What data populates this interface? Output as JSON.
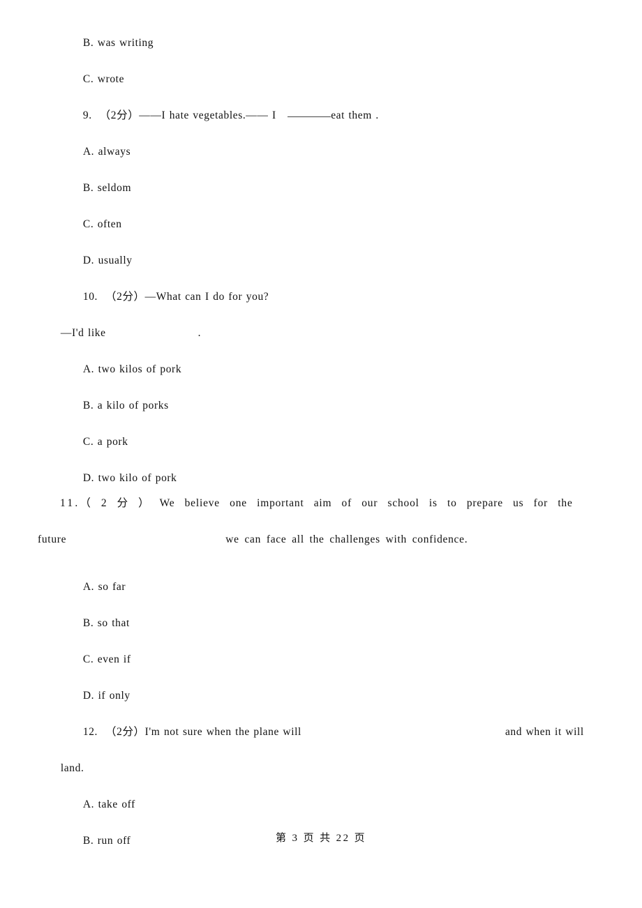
{
  "document": {
    "page_footer": "第 3 页 共 22 页"
  },
  "carryover_options": [
    {
      "letter": "B",
      "sep": ".",
      "text": "was writing"
    },
    {
      "letter": "C",
      "sep": ".",
      "text": "wrote"
    }
  ],
  "questions": [
    {
      "number": "9.",
      "score": "（2分）",
      "stem_before_blank": "——I hate vegetables.—— I",
      "blank_type": "underline",
      "stem_after_blank": "eat them .",
      "options": [
        {
          "letter": "A",
          "sep": ".",
          "text": "always"
        },
        {
          "letter": "B",
          "sep": ".",
          "text": "seldom"
        },
        {
          "letter": "C",
          "sep": ".",
          "text": "often"
        },
        {
          "letter": "D",
          "sep": ".",
          "text": "usually"
        }
      ]
    },
    {
      "number": "10.",
      "score": "（2分）",
      "stem_line1": "—What can I do for you?",
      "stem_line2_before_blank": "—I'd like",
      "blank_type": "whitespace",
      "stem_line2_after_blank": ".",
      "options": [
        {
          "letter": "A",
          "sep": ".",
          "text": "two kilos of pork"
        },
        {
          "letter": "B",
          "sep": ".",
          "text": "a kilo of porks"
        },
        {
          "letter": "C",
          "sep": ".",
          "text": "a pork"
        },
        {
          "letter": "D",
          "sep": ".",
          "text": "two kilo of pork"
        }
      ]
    },
    {
      "number": "11.",
      "score": "（ 2 分 ）",
      "stem_line1": "We believe one important aim of our school is to prepare us for the",
      "stem_line2_before_blank": "future",
      "blank_type": "whitespace",
      "stem_line2_after_blank": "we can face all the challenges with confidence.",
      "options": [
        {
          "letter": "A",
          "sep": ".",
          "text": "so far"
        },
        {
          "letter": "B",
          "sep": ".",
          "text": "so that"
        },
        {
          "letter": "C",
          "sep": ".",
          "text": "even if"
        },
        {
          "letter": "D",
          "sep": ".",
          "text": "if only"
        }
      ]
    },
    {
      "number": "12.",
      "score": "（2分）",
      "stem_line1_before_blank": "I'm not sure when the plane will",
      "blank_type": "whitespace",
      "stem_line1_after_blank": "and when it will",
      "stem_line2": "land.",
      "options": [
        {
          "letter": "A",
          "sep": ".",
          "text": "take off"
        },
        {
          "letter": "B",
          "sep": ".",
          "text": "run off"
        }
      ]
    }
  ]
}
